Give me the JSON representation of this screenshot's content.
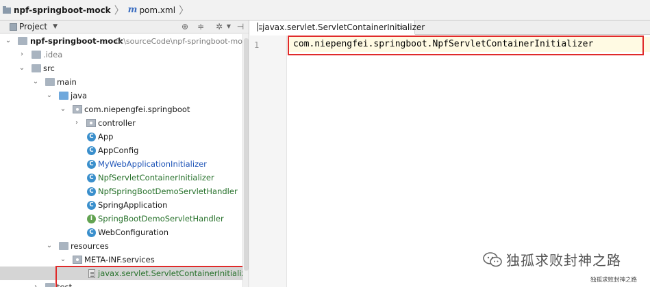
{
  "breadcrumb": {
    "project": "npf-springboot-mock",
    "file": "pom.xml"
  },
  "panel": {
    "title": "Project",
    "icons": [
      "crosshair-icon",
      "collapse-icon",
      "gear-icon",
      "hide-icon"
    ]
  },
  "tree": {
    "root_name": "npf-springboot-mock",
    "root_path": "G:\\sourceCode\\npf-springboot-mock",
    "idea": ".idea",
    "src": "src",
    "main": "main",
    "java": "java",
    "package": "com.niepengfei.springboot",
    "controller": "controller",
    "classes": [
      {
        "name": "App",
        "icon": "C",
        "color": "default"
      },
      {
        "name": "AppConfig",
        "icon": "C",
        "color": "default"
      },
      {
        "name": "MyWebApplicationInitializer",
        "icon": "C",
        "color": "blue"
      },
      {
        "name": "NpfServletContainerInitializer",
        "icon": "C",
        "color": "green"
      },
      {
        "name": "NpfSpringBootDemoServletHandler",
        "icon": "C",
        "color": "green"
      },
      {
        "name": "SpringApplication",
        "icon": "C",
        "color": "default"
      },
      {
        "name": "SpringBootDemoServletHandler",
        "icon": "I",
        "color": "green"
      },
      {
        "name": "WebConfiguration",
        "icon": "C",
        "color": "default"
      }
    ],
    "resources": "resources",
    "meta_inf": "META-INF.services",
    "service_file": "javax.servlet.ServletContainerInitializer",
    "test": "test"
  },
  "editor": {
    "tab_label": "javax.servlet.ServletContainerInitializer",
    "line_number": "1",
    "code_line": "com.niepengfei.springboot.NpfServletContainerInitializer"
  },
  "watermark": {
    "text": "独孤求败封神之路",
    "small_text": "独孤求败封神之路"
  },
  "colors": {
    "highlight_border": "#e02a2a",
    "blue_text": "#1f55b8",
    "green_text": "#257029"
  }
}
